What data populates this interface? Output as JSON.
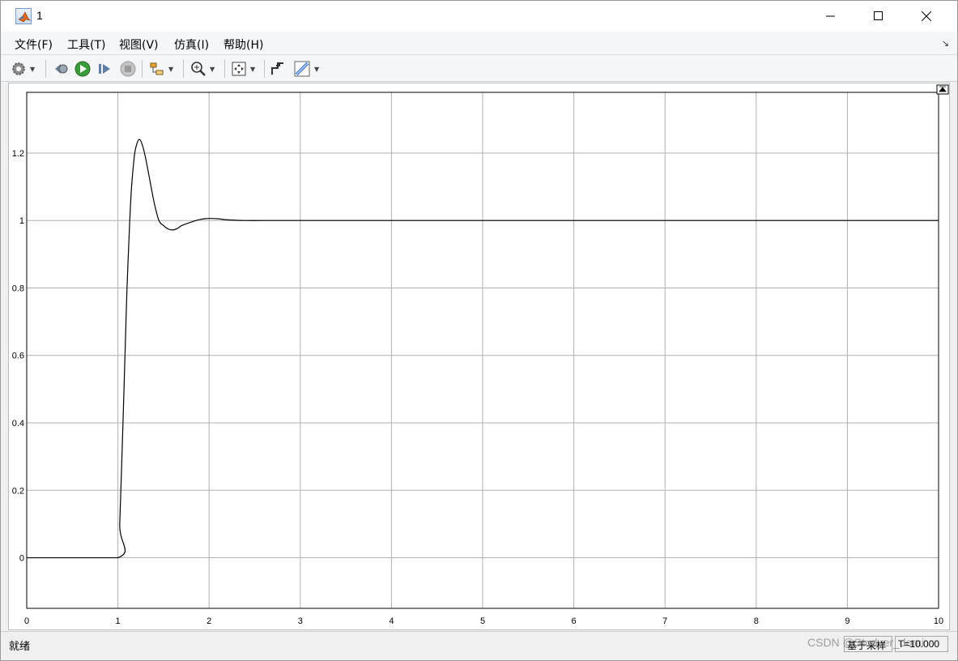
{
  "window": {
    "title": "1",
    "minimize_icon": "minimize-icon",
    "maximize_icon": "maximize-icon",
    "close_icon": "close-icon"
  },
  "menu": {
    "items": [
      "文件(F)",
      "工具(T)",
      "视图(V)",
      "仿真(I)",
      "帮助(H)"
    ],
    "overflow_icon": "dock-arrow-icon"
  },
  "toolbar": {
    "icons": [
      "settings-gear-icon",
      "step-back-icon",
      "run-icon",
      "step-forward-icon",
      "stop-icon",
      "signal-select-icon",
      "zoom-in-icon",
      "fit-to-view-icon",
      "style-icon",
      "measure-icon"
    ]
  },
  "status": {
    "text": "就绪",
    "sample_mode": "基于采样",
    "time": "T=10.000"
  },
  "watermark": "CSDN @Studyer_domi",
  "colors": {
    "line": "#000000",
    "grid": "#b0b0b0",
    "plot_bg": "#ffffff"
  },
  "chart_data": {
    "type": "line",
    "title": "",
    "xlabel": "",
    "ylabel": "",
    "xlim": [
      0,
      10
    ],
    "ylim": [
      -0.15,
      1.38
    ],
    "grid": true,
    "xticks": [
      0,
      1,
      2,
      3,
      4,
      5,
      6,
      7,
      8,
      9,
      10
    ],
    "xtick_labels": [
      "0",
      "1",
      "2",
      "3",
      "4",
      "5",
      "6",
      "7",
      "8",
      "9",
      "10"
    ],
    "yticks": [
      0,
      0.2,
      0.4,
      0.6,
      0.8,
      1,
      1.2
    ],
    "ytick_labels": [
      "0",
      "0.2",
      "0.4",
      "0.6",
      "0.8",
      "1",
      "1.2"
    ],
    "series": [
      {
        "x": [
          0,
          1,
          1.02,
          1.05,
          1.08,
          1.1,
          1.13,
          1.15,
          1.18,
          1.2,
          1.23,
          1.26,
          1.3,
          1.35,
          1.4,
          1.45,
          1.5,
          1.55,
          1.6,
          1.65,
          1.7,
          1.8,
          1.9,
          2.0,
          2.1,
          2.2,
          2.4,
          2.6,
          3,
          4,
          5,
          6,
          7,
          8,
          9,
          10
        ],
        "y": [
          0,
          0,
          0.1,
          0.35,
          0.62,
          0.8,
          1.0,
          1.1,
          1.19,
          1.22,
          1.24,
          1.23,
          1.19,
          1.12,
          1.05,
          1.0,
          0.985,
          0.975,
          0.972,
          0.976,
          0.985,
          0.995,
          1.003,
          1.006,
          1.005,
          1.002,
          1.0,
          1.0,
          1.0,
          1.0,
          1.0,
          1.0,
          1.0,
          1.0,
          1.0,
          1.0
        ]
      }
    ]
  }
}
